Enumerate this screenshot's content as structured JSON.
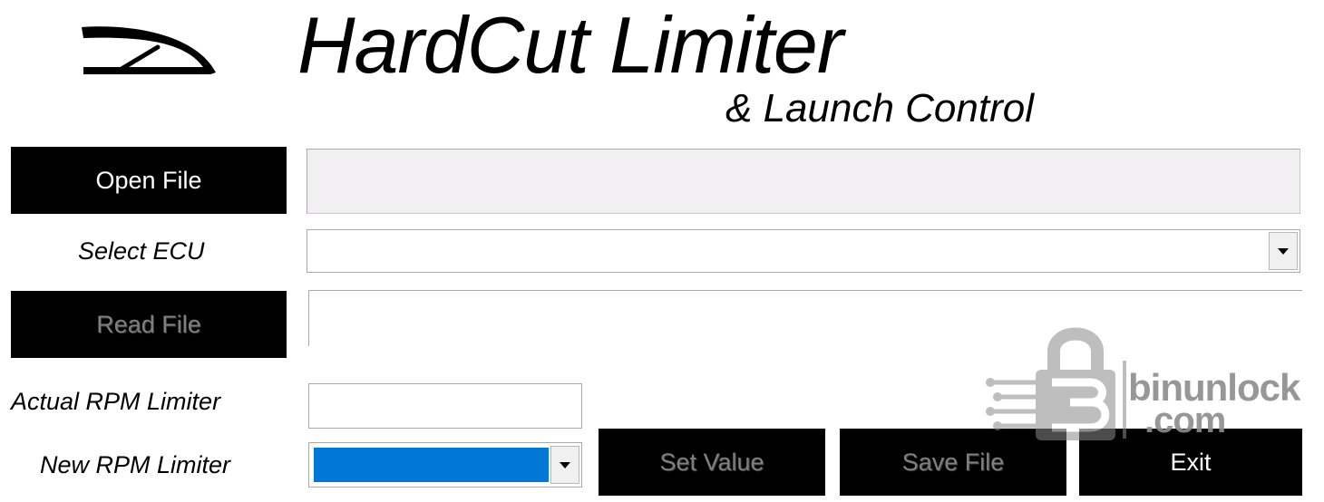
{
  "header": {
    "title": "HardCut Limiter",
    "subtitle": "& Launch Control",
    "logo_icon": "tachometer-gauge-icon"
  },
  "buttons": {
    "open_file": "Open File",
    "read_file": "Read File",
    "set_value": "Set Value",
    "save_file": "Save File",
    "exit": "Exit"
  },
  "labels": {
    "select_ecu": "Select ECU",
    "actual_rpm": "Actual RPM Limiter",
    "new_rpm": "New RPM Limiter"
  },
  "fields": {
    "file_path": "",
    "ecu_selected": "",
    "info": "",
    "actual_rpm_value": "",
    "new_rpm_selected": ""
  },
  "watermark": {
    "line1": "binunlock",
    "line2": ".com"
  },
  "colors": {
    "button_bg": "#000000",
    "button_text": "#ffffff",
    "disabled_text": "#7f7f7f",
    "selection_blue": "#0078d7",
    "file_field_bg": "#f1eff1"
  }
}
